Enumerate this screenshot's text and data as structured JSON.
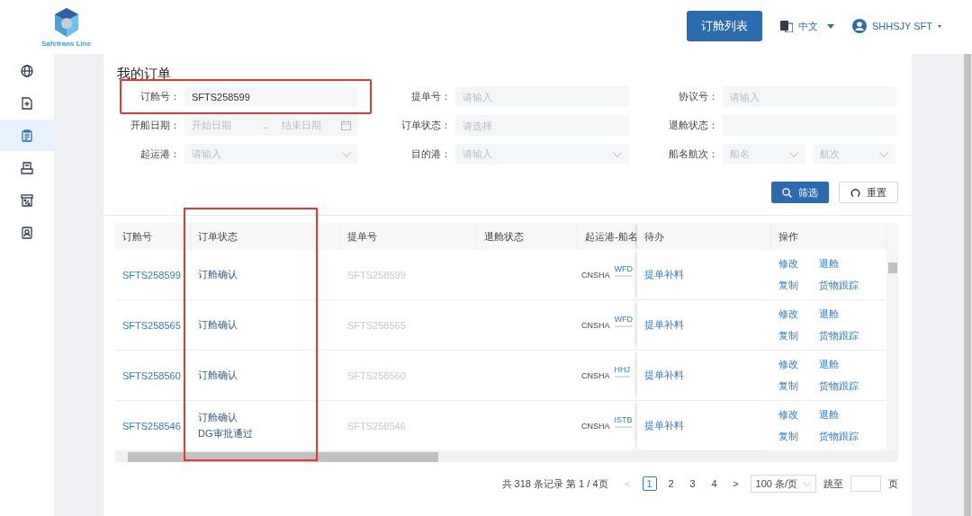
{
  "header": {
    "logo_text": "Safetrans Line",
    "list_button": "订舱列表",
    "language": "中文",
    "user": "SHHSJY SFT"
  },
  "sidebar": {
    "items": [
      {
        "selected": false
      },
      {
        "selected": false
      },
      {
        "selected": true
      },
      {
        "selected": false
      },
      {
        "selected": false
      },
      {
        "selected": false
      }
    ]
  },
  "page_title": "我的订单",
  "filters": [
    {
      "label": "订舱号：",
      "kind": "text",
      "value": "SFTS258599",
      "highlighted": true
    },
    {
      "label": "提单号：",
      "kind": "text",
      "placeholder": "请输入",
      "highlighted": false
    },
    {
      "label": "协议号：",
      "kind": "text",
      "placeholder": "请输入",
      "highlighted": false
    },
    {
      "label": "开船日期：",
      "kind": "date-range",
      "placeholder": "开始日期",
      "placeholder_end": "结束日期",
      "separator": "→",
      "highlighted": false
    },
    {
      "label": "订单状态：",
      "kind": "text",
      "placeholder": "请选择",
      "highlighted": false
    },
    {
      "label": "退舱状态：",
      "kind": "text",
      "highlighted": false
    },
    {
      "label": "起运港：",
      "kind": "select",
      "placeholder": "请输入",
      "highlighted": false
    },
    {
      "label": "目的港：",
      "kind": "select",
      "placeholder": "请输入",
      "highlighted": false
    },
    {
      "label": "船名航次：",
      "kind": "double-select",
      "placeholder": "船名",
      "placeholder_end": "航次",
      "highlighted": false
    }
  ],
  "filter_buttons": {
    "search": "筛选",
    "reset": "重置"
  },
  "table": {
    "columns": [
      {
        "label": "订舱号",
        "highlighted": false
      },
      {
        "label": "订单状态",
        "highlighted": true
      },
      {
        "label": "提单号",
        "highlighted": false
      },
      {
        "label": "退舱状态",
        "highlighted": false
      },
      {
        "label": "起运港-船名",
        "highlighted": false
      },
      {
        "label": "待办",
        "highlighted": false
      },
      {
        "label": "操作",
        "highlighted": false
      }
    ],
    "rows": [
      {
        "order_no": "SFTS258599",
        "status": [
          "订舱确认"
        ],
        "bl_no": "SFTS258599",
        "origin": "CNSHA",
        "vessel": "WFD",
        "todo": "提单补料",
        "actions": [
          "修改",
          "退舱",
          "复制",
          "货物跟踪"
        ]
      },
      {
        "order_no": "SFTS258565",
        "status": [
          "订舱确认"
        ],
        "bl_no": "SFTS258565",
        "origin": "CNSHA",
        "vessel": "WFD",
        "todo": "提单补料",
        "actions": [
          "修改",
          "退舱",
          "复制",
          "货物跟踪"
        ]
      },
      {
        "order_no": "SFTS258560",
        "status": [
          "订舱确认"
        ],
        "bl_no": "SFTS258560",
        "origin": "CNSHA",
        "vessel": "HHJ",
        "todo": "提单补料",
        "actions": [
          "修改",
          "退舱",
          "复制",
          "货物跟踪"
        ]
      },
      {
        "order_no": "SFTS258546",
        "status": [
          "订舱确认",
          "DG审批通过"
        ],
        "bl_no": "SFTS258546",
        "origin": "CNSHA",
        "vessel": "ISTB",
        "todo": "提单补料",
        "actions": [
          "修改",
          "退舱",
          "复制",
          "货物跟踪"
        ]
      }
    ]
  },
  "pagination": {
    "summary": "共 318 条记录 第 1 / 4页",
    "prev": "<",
    "pages": [
      {
        "label": "1",
        "selected": true
      },
      {
        "label": "2",
        "selected": false
      },
      {
        "label": "3",
        "selected": false
      },
      {
        "label": "4",
        "selected": false
      }
    ],
    "next": ">",
    "page_size": "100 条/页",
    "jump_label": "跳至",
    "page_unit": "页"
  }
}
